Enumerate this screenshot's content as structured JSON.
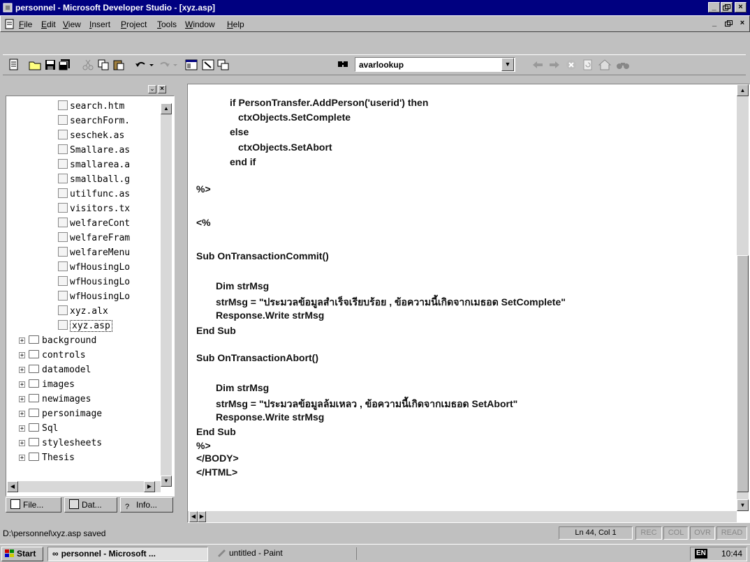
{
  "window": {
    "title": "personnel - Microsoft Developer Studio - [xyz.asp]"
  },
  "menu": {
    "items": [
      "File",
      "Edit",
      "View",
      "Insert",
      "Project",
      "Tools",
      "Window",
      "Help"
    ],
    "underline": [
      "F",
      "E",
      "V",
      "I",
      "P",
      "T",
      "W",
      "H"
    ]
  },
  "toolbar": {
    "combo_value": "avarlookup"
  },
  "workspace": {
    "files": [
      "search.htm",
      "searchForm.",
      "seschek.as",
      "Smallare.as",
      "smallarea.a",
      "smallball.g",
      "utilfunc.as",
      "visitors.tx",
      "welfareCont",
      "welfareFram",
      "welfareMenu",
      "wfHousingLo",
      "wfHousingLo",
      "wfHousingLo",
      "xyz.alx",
      "xyz.asp"
    ],
    "folders": [
      "background",
      "controls",
      "datamodel",
      "images",
      "newimages",
      "personimage",
      "Sql",
      "stylesheets",
      "Thesis"
    ],
    "tabs": [
      "File...",
      "Dat...",
      "Info..."
    ]
  },
  "editor": {
    "lines": [
      "if PersonTransfer.AddPerson('userid') then",
      "ctxObjects.SetComplete",
      "else",
      "ctxObjects.SetAbort",
      "end if",
      "%>",
      "<%",
      "Sub OnTransactionCommit()",
      "Dim strMsg",
      "strMsg = \"ประมวลข้อมูลสำเร็จเรียบร้อย , ข้อความนี้เกิดจากเมธอด SetComplete\"",
      "Response.Write strMsg",
      "End Sub",
      "Sub OnTransactionAbort()",
      "Dim strMsg",
      "strMsg = \"ประมวลข้อมูลล้มเหลว , ข้อความนี้เกิดจากเมธอด SetAbort\"",
      "Response.Write strMsg",
      "End Sub",
      "%>",
      "</BODY>",
      "</HTML>"
    ]
  },
  "status": {
    "message": "D:\\personnel\\xyz.asp saved",
    "position": "Ln 44, Col 1",
    "indicators": [
      "REC",
      "COL",
      "OVR",
      "READ"
    ]
  },
  "taskbar": {
    "start": "Start",
    "buttons": [
      "personnel - Microsoft ...",
      "untitled - Paint"
    ],
    "lang": "EN",
    "clock": "10:44"
  }
}
